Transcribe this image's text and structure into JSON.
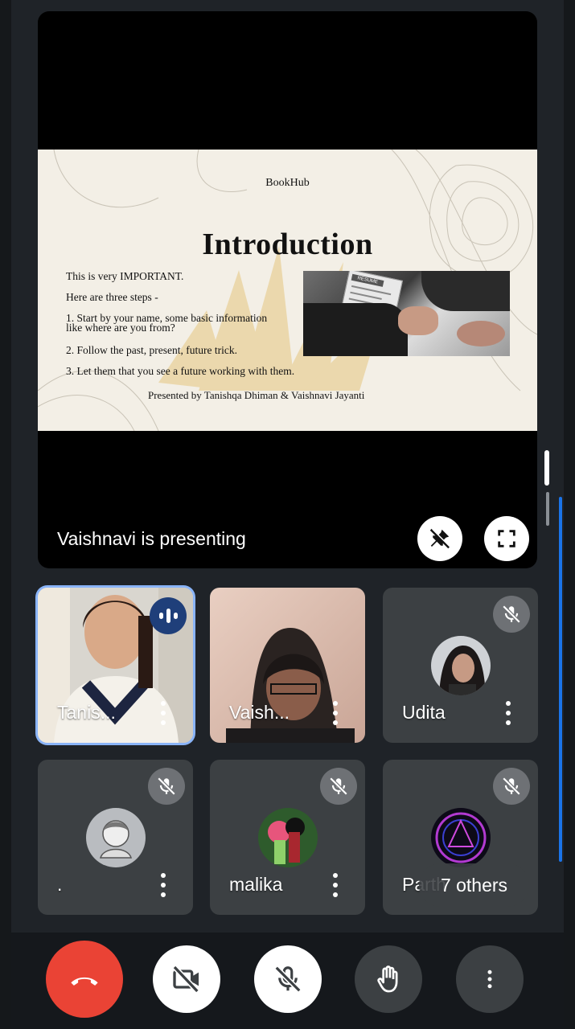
{
  "presentation": {
    "presenting_label": "Vaishnavi is presenting",
    "slide": {
      "brand": "BookHub",
      "title": "Introduction",
      "lines": [
        "This is very IMPORTANT.",
        "Here are three steps -",
        "1. Start by your name, some basic information like where are you from?",
        "2. Follow the past, present, future trick.",
        "3. Let them that you see a future working with them."
      ],
      "footer": "Presented by Tanishqa Dhiman & Vaishnavi Jayanti",
      "photo_label": "RESUME"
    }
  },
  "participants": [
    {
      "name": "Tanis...",
      "state": "speaking"
    },
    {
      "name": "Vaish...",
      "state": "video"
    },
    {
      "name": "Udita",
      "state": "muted"
    },
    {
      "name": ".",
      "state": "muted"
    },
    {
      "name": "malika",
      "state": "muted"
    },
    {
      "name": "Parth",
      "state": "muted"
    }
  ],
  "others_chip": "7 others",
  "controls": {
    "end_call": "end-call",
    "camera": "camera-off",
    "mic": "mic-off",
    "raise_hand": "raise-hand",
    "more": "more-options"
  },
  "colors": {
    "end_call": "#ea4335",
    "accent": "#1a73e8",
    "active_border": "#8ab4f8",
    "tile_bg": "#3c4043"
  }
}
